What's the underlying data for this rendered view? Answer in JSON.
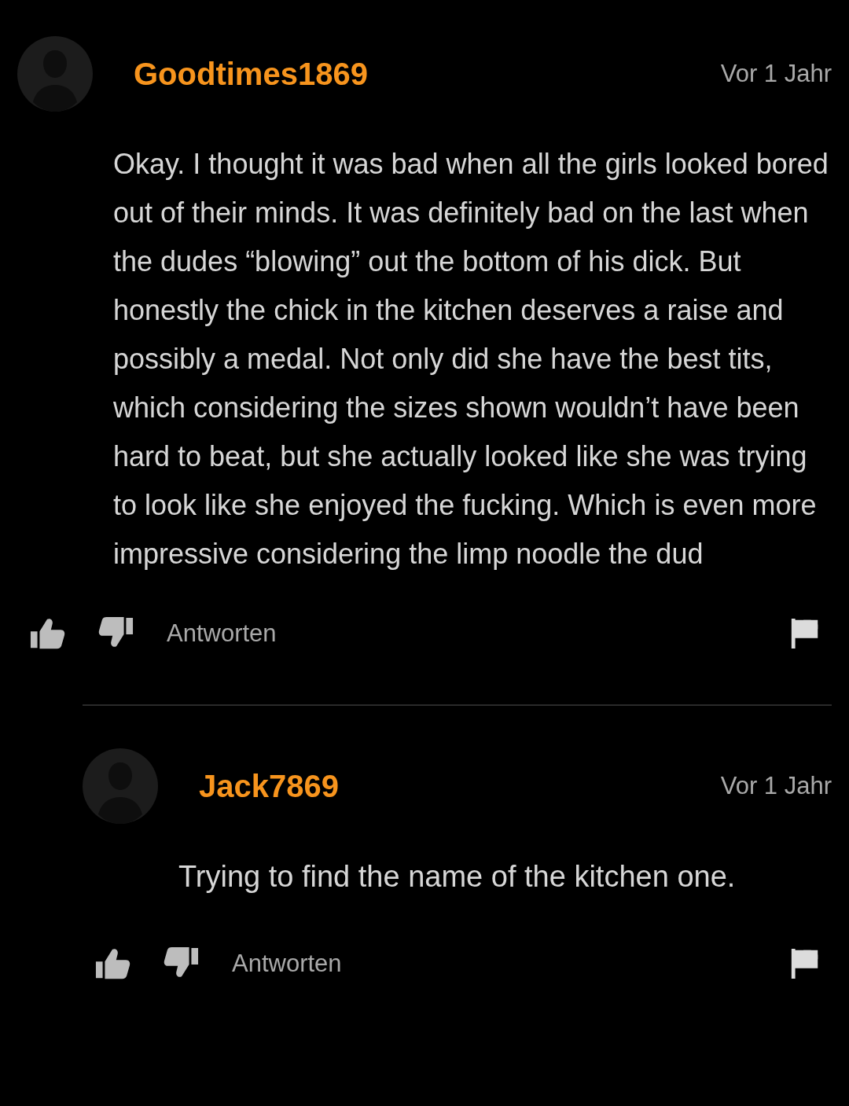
{
  "comments": [
    {
      "username": "Goodtimes1869",
      "time": "Vor 1 Jahr",
      "body": "Okay. I thought it was bad when all the girls looked bored out of their minds. It was definitely bad on the last when the dudes “blowing” out the bottom of his dick. But honestly the chick in the kitchen deserves a raise and possibly a medal. Not only did she have the best tits, which considering the sizes shown wouldn’t have been hard to beat, but she actually looked like she was trying to look like she enjoyed the fucking. Which is even more impressive considering the limp noodle the dud",
      "reply_label": "Antworten",
      "children": [
        {
          "username": "Jack7869",
          "time": "Vor 1 Jahr",
          "body": "Trying to find the name of the kitchen one.",
          "reply_label": "Antworten"
        }
      ]
    }
  ]
}
